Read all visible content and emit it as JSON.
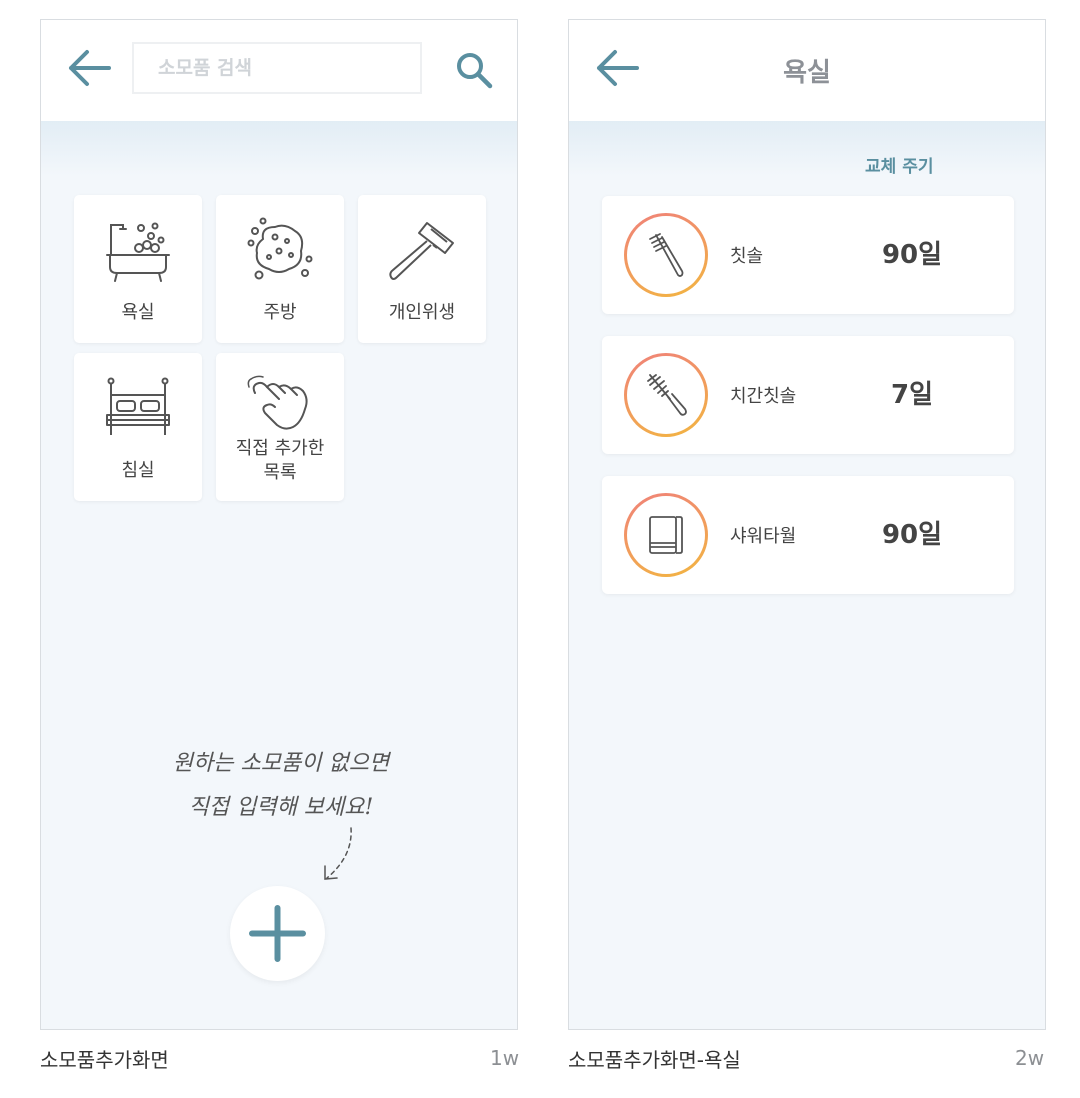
{
  "screen1": {
    "search": {
      "placeholder": "소모품 검색"
    },
    "categories": [
      {
        "label": "욕실",
        "icon": "bathtub-icon"
      },
      {
        "label": "주방",
        "icon": "sponge-icon"
      },
      {
        "label": "개인위생",
        "icon": "razor-icon"
      },
      {
        "label": "침실",
        "icon": "bed-icon"
      },
      {
        "label_line1": "직접 추가한",
        "label_line2": "목록",
        "icon": "hand-pointer-icon"
      }
    ],
    "hint_line1": "원하는 소모품이 없으면",
    "hint_line2": "직접 입력해 보세요!",
    "caption": "소모품추가화면",
    "badge": "1w"
  },
  "screen2": {
    "title": "욕실",
    "column_header": "교체 주기",
    "items": [
      {
        "name": "칫솔",
        "days": "90일",
        "icon": "toothbrush-icon"
      },
      {
        "name": "치간칫솔",
        "days": "7일",
        "icon": "interdental-brush-icon"
      },
      {
        "name": "샤워타월",
        "days": "90일",
        "icon": "towel-icon"
      }
    ],
    "caption": "소모품추가화면-욕실",
    "badge": "2w"
  },
  "colors": {
    "accent": "#5a8fa0",
    "ring_start": "#f0817a",
    "ring_end": "#f2b640",
    "background": "#f3f7fb"
  }
}
